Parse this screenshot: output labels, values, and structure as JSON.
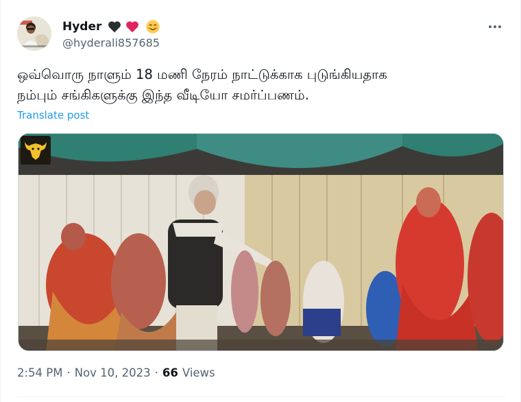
{
  "tweet": {
    "display_name": "Hyder",
    "emojis": [
      "black-heart",
      "red-heart",
      "smiling-face-with-smiling-eyes"
    ],
    "handle": "@hyderali857685",
    "text_lines": [
      "ஒவ்வொரு நாளும் 18 மணி நேரம் நாட்டுக்காக புடுங்கியதாக",
      "நம்பும் சங்கிகளுக்கு இந்த வீடியோ சமர்ப்பணம்."
    ],
    "translate_label": "Translate post",
    "time": "2:54 PM",
    "separator": "·",
    "date": "Nov 10, 2023",
    "views_count": "66",
    "views_label": "Views"
  },
  "colors": {
    "accent": "#1d9bf0",
    "text_primary": "#0f1419",
    "text_secondary": "#536471",
    "heart_red": "#e0245e",
    "heart_black": "#292f33",
    "media_logo_gold": "#f2c12e"
  },
  "icons": {
    "more": "more-horizontal-icon",
    "media_logo": "bull-logo-icon"
  }
}
